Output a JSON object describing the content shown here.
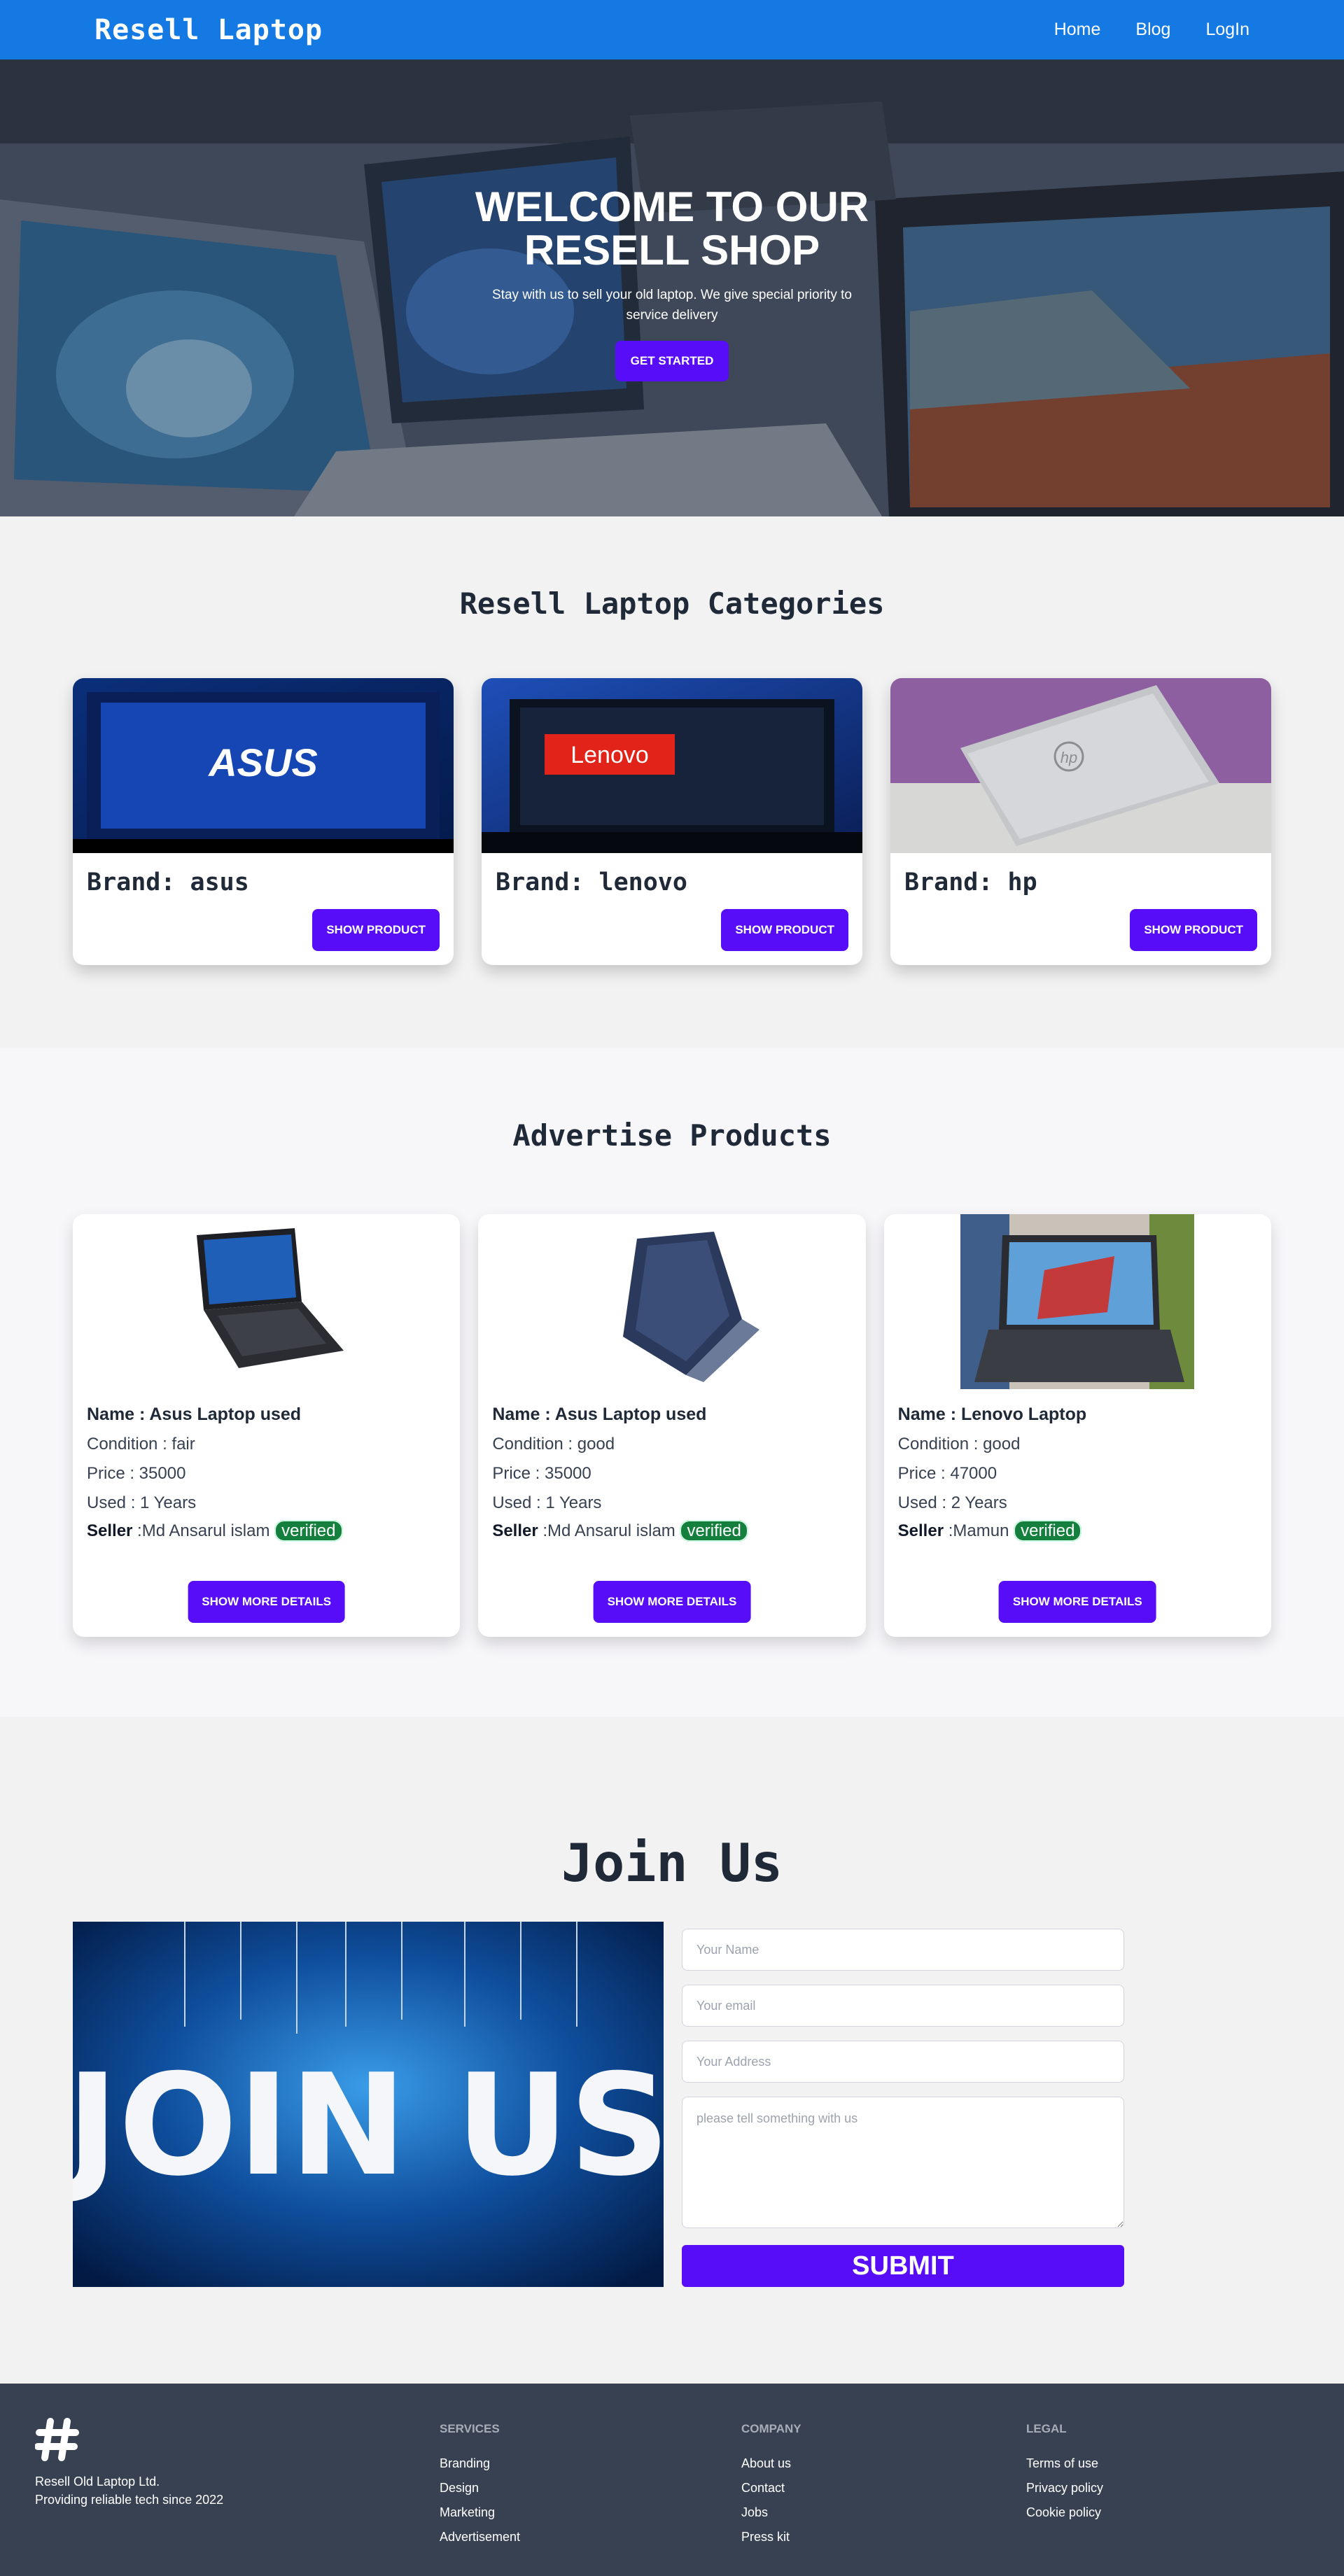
{
  "nav": {
    "brand": "Resell Laptop",
    "links": [
      "Home",
      "Blog",
      "LogIn"
    ]
  },
  "hero": {
    "title": "WELCOME TO OUR RESELL SHOP",
    "subtitle": "Stay with us to sell your old laptop. We give special priority to service delivery",
    "button": "GET STARTED"
  },
  "categories": {
    "title": "Resell Laptop Categories",
    "items": [
      {
        "brand_label": "Brand: asus",
        "logo_text": "ASUS",
        "button": "SHOW PRODUCT"
      },
      {
        "brand_label": "Brand: lenovo",
        "logo_text": "Lenovo",
        "button": "SHOW PRODUCT"
      },
      {
        "brand_label": "Brand: hp",
        "logo_text": "hp",
        "button": "SHOW PRODUCT"
      }
    ]
  },
  "advertise": {
    "title": "Advertise Products",
    "items": [
      {
        "name": "Name : Asus Laptop used",
        "condition": "Condition : fair",
        "price": "Price : 35000",
        "used": "Used : 1 Years",
        "seller_label": "Seller",
        "seller": " :Md Ansarul islam ",
        "badge": "verified",
        "button": "SHOW MORE DETAILS"
      },
      {
        "name": "Name : Asus Laptop used",
        "condition": "Condition : good",
        "price": "Price : 35000",
        "used": "Used : 1 Years",
        "seller_label": "Seller",
        "seller": " :Md Ansarul islam ",
        "badge": "verified",
        "button": "SHOW MORE DETAILS"
      },
      {
        "name": "Name : Lenovo Laptop",
        "condition": "Condition : good",
        "price": "Price : 47000",
        "used": "Used : 2 Years",
        "seller_label": "Seller",
        "seller": " :Mamun ",
        "badge": "verified",
        "button": "SHOW MORE DETAILS"
      }
    ]
  },
  "join": {
    "title": "Join Us",
    "image_text": "JOIN US",
    "name_placeholder": "Your Name",
    "email_placeholder": "Your email",
    "address_placeholder": "Your Address",
    "message_placeholder": "please tell something with us",
    "submit": "SUBMIT"
  },
  "footer": {
    "company_name": "Resell Old Laptop Ltd.",
    "tagline": "Providing reliable tech since 2022",
    "columns": [
      {
        "title": "SERVICES",
        "links": [
          "Branding",
          "Design",
          "Marketing",
          "Advertisement"
        ]
      },
      {
        "title": "COMPANY",
        "links": [
          "About us",
          "Contact",
          "Jobs",
          "Press kit"
        ]
      },
      {
        "title": "LEGAL",
        "links": [
          "Terms of use",
          "Privacy policy",
          "Cookie policy"
        ]
      }
    ]
  },
  "colors": {
    "nav": "#1479e3",
    "primary_button": "#570df8",
    "footer": "#374151",
    "verified": "#15803d"
  }
}
